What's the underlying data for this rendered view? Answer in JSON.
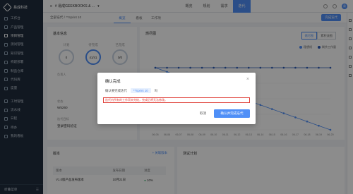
{
  "sidebar": {
    "brand": "易成科技",
    "items": [
      {
        "label": "工作台"
      },
      {
        "label": "产品管理"
      },
      {
        "label": "项目管理"
      },
      {
        "label": "测试管理"
      },
      {
        "label": "知识管理"
      },
      {
        "label": "构建部署"
      },
      {
        "label": "制品仓库"
      },
      {
        "label": "代码库"
      },
      {
        "label": "度量"
      }
    ],
    "items2": [
      {
        "label": "工时管理"
      },
      {
        "label": "流水线"
      },
      {
        "label": "日程"
      },
      {
        "label": "待办"
      },
      {
        "label": "我的看板"
      }
    ],
    "footer_label": "折叠菜单"
  },
  "header": {
    "project": "# 易成GEEKBOOKS & ...",
    "tabs": [
      {
        "label": "概览"
      },
      {
        "label": "规划"
      },
      {
        "label": "需求"
      },
      {
        "label": "迭代"
      }
    ],
    "active_tab": 3,
    "avatar_text": "易"
  },
  "subheader": {
    "crumb": "全部迭代 / **Sprint 10",
    "tabs": [
      {
        "label": "概览"
      },
      {
        "label": "看板"
      },
      {
        "label": "工作项"
      }
    ],
    "action": "完成迭代"
  },
  "basic_info": {
    "title": "基本信息",
    "circles": [
      {
        "label": "计划",
        "value": "0"
      },
      {
        "label": "待完成",
        "value": "41/41"
      },
      {
        "label": "已完成",
        "value": "0/0"
      }
    ],
    "fields": [
      {
        "label": "负责人",
        "value": ""
      },
      {
        "label": "状态",
        "value": "W5260"
      },
      {
        "label": "迭代目标",
        "value": "登录密码验证"
      }
    ]
  },
  "burndown": {
    "title": "燃尽图",
    "toggle": [
      "燃尽图",
      "累积流图"
    ],
    "legend": [
      "理想线",
      "剩余工作量"
    ]
  },
  "chart_data": {
    "type": "line",
    "x": [
      "06-05",
      "06-06",
      "06-07",
      "06-08",
      "06-09",
      "06-10",
      "06-11",
      "06-12",
      "06-13",
      "06-14",
      "06-15",
      "06-16",
      "06-17",
      "06-18",
      "06-19",
      "06-20"
    ],
    "series": [
      {
        "name": "理想线",
        "values": [
          41,
          38.3,
          35.5,
          32.8,
          30.1,
          27.3,
          24.6,
          21.9,
          19.1,
          16.4,
          13.7,
          10.9,
          8.2,
          5.5,
          2.7,
          0
        ]
      },
      {
        "name": "剩余工作量",
        "values": [
          41,
          41,
          41,
          41,
          41,
          41,
          41,
          41,
          41,
          41,
          41,
          41,
          41,
          41,
          41,
          41
        ]
      }
    ],
    "colors": [
      "#4f8ff7",
      "#2c5bb5"
    ]
  },
  "versions": {
    "title": "版本",
    "add": "+ 关联版本",
    "columns": [
      "版本",
      "发布日期",
      "进度"
    ],
    "rows": [
      [
        "V1.0版产品发布版本",
        "10月21日",
        "10%"
      ]
    ]
  },
  "test_plan": {
    "title": "测试计划"
  },
  "modal": {
    "title": "确认完成",
    "row_label": "确认要完成迭代",
    "sprint": "**Sprint 10",
    "row_suffix": "吗",
    "warning": "迭代内所有的工作项未完结，完成后将无法修改。",
    "cancel": "取消",
    "confirm": "确认并完成迭代"
  }
}
